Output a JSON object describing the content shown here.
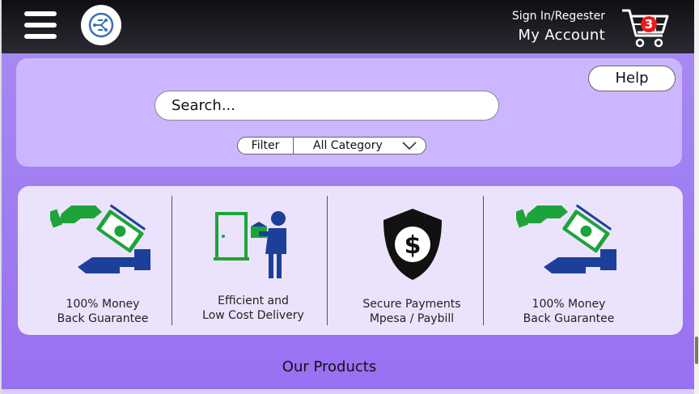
{
  "header": {
    "menu_icon": "hamburger-icon",
    "logo_icon": "circuit-brain-logo",
    "signin_label": "Sign In/Regester",
    "account_label": "My Account",
    "cart_icon": "cart-icon",
    "cart_count": "3"
  },
  "search_panel": {
    "help_label": "Help",
    "search_placeholder": "Search...",
    "filter_label": "Filter",
    "category_value": "All Category"
  },
  "features": [
    {
      "icon": "money-hand-icon",
      "line1": "100% Money",
      "line2": "Back Guarantee"
    },
    {
      "icon": "delivery-door-icon",
      "line1": "Efficient and",
      "line2": "Low Cost Delivery"
    },
    {
      "icon": "shield-dollar-icon",
      "line1": "Secure Payments",
      "line2": "Mpesa / Paybill"
    },
    {
      "icon": "money-hand-icon",
      "line1": "100% Money",
      "line2": "Back Guarantee"
    }
  ],
  "products": {
    "title": "Our Products"
  },
  "colors": {
    "page_bg": "#9870f2",
    "header_bg": "#1a1a20",
    "panel_bg": "#ccb6ff",
    "features_bg": "#ebe3fb",
    "cart_badge": "#e81d1d",
    "money_green": "#1ea33a",
    "hand_blue": "#1c3f9a"
  }
}
